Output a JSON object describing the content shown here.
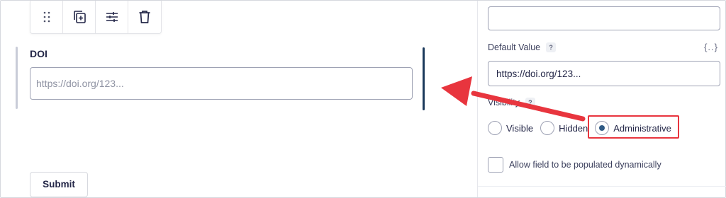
{
  "toolbar": {
    "icons": [
      "drag-handle-icon",
      "duplicate-icon",
      "settings-sliders-icon",
      "trash-icon"
    ]
  },
  "field": {
    "label": "DOI",
    "placeholder": "https://doi.org/123..."
  },
  "submit": {
    "label": "Submit"
  },
  "panel": {
    "default_value_label": "Default Value",
    "help_glyph": "?",
    "merge_tag_glyph": "{..}",
    "default_value": "https://doi.org/123...",
    "visibility_label": "Visibility",
    "visibility_options": [
      {
        "label": "Visible",
        "checked": false
      },
      {
        "label": "Hidden",
        "checked": false
      },
      {
        "label": "Administrative",
        "checked": true
      }
    ],
    "dynamic_population_label": "Allow field to be populated dynamically"
  },
  "colors": {
    "accent": "#1c3a5c",
    "annotation_red": "#e8353e",
    "radio_selected": "#2f5a85",
    "border": "#9ea2b4"
  }
}
